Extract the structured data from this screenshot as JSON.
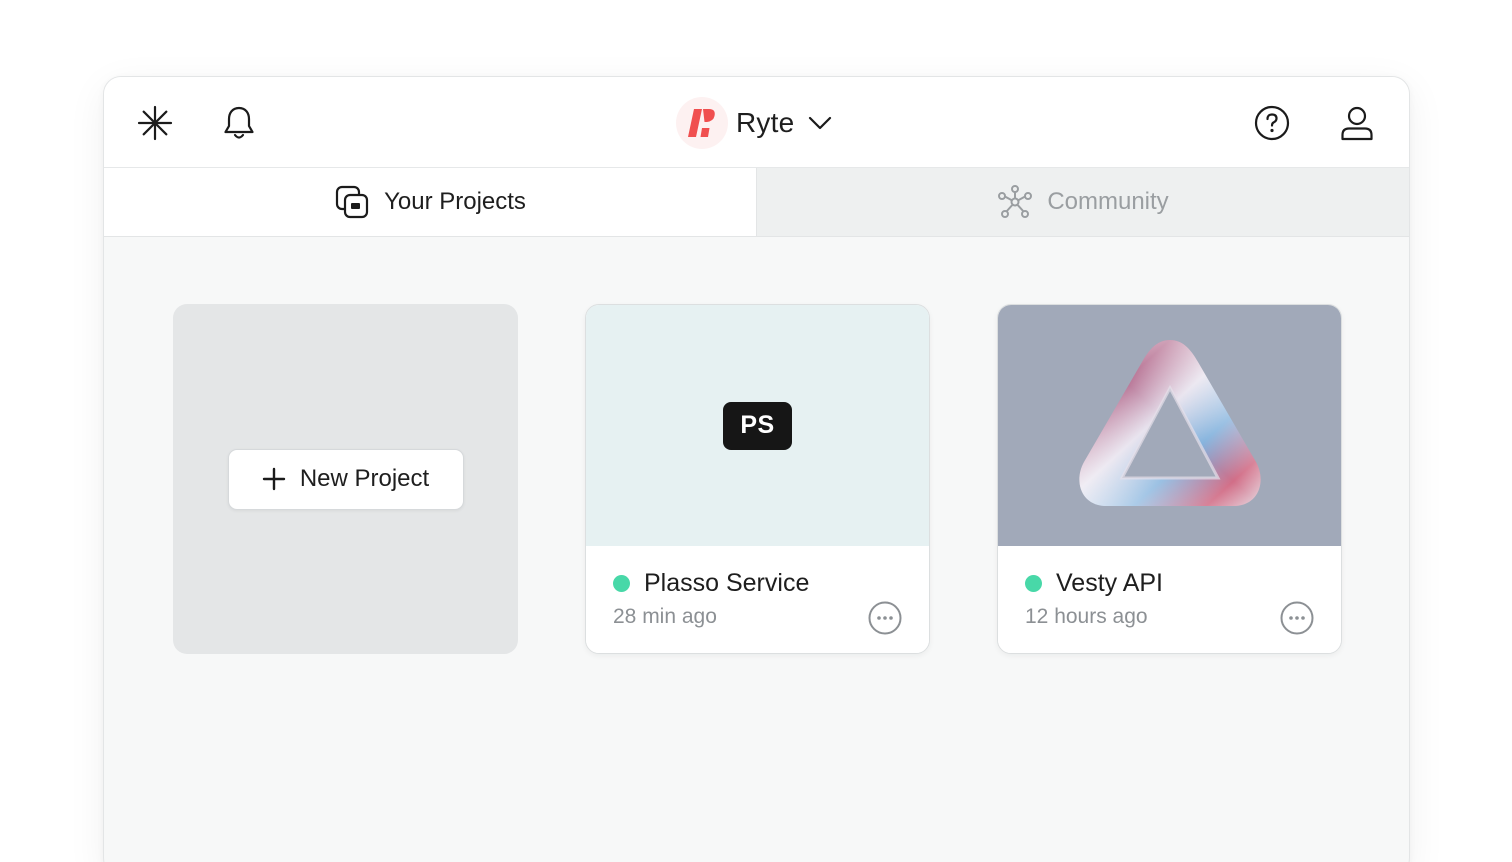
{
  "header": {
    "brand_name": "Ryte",
    "brand_accent": "#f04f4f"
  },
  "tabs": [
    {
      "label": "Your Projects",
      "active": true
    },
    {
      "label": "Community",
      "active": false
    }
  ],
  "new_project": {
    "label": "New Project"
  },
  "projects": [
    {
      "name": "Plasso Service",
      "time": "28 min ago",
      "badge": "PS",
      "status_color": "#48d8a8"
    },
    {
      "name": "Vesty API",
      "time": "12 hours ago",
      "status_color": "#48d8a8"
    }
  ],
  "icons": {
    "left": [
      "sparkle-icon",
      "bell-icon"
    ],
    "right": [
      "help-icon",
      "user-icon"
    ]
  }
}
